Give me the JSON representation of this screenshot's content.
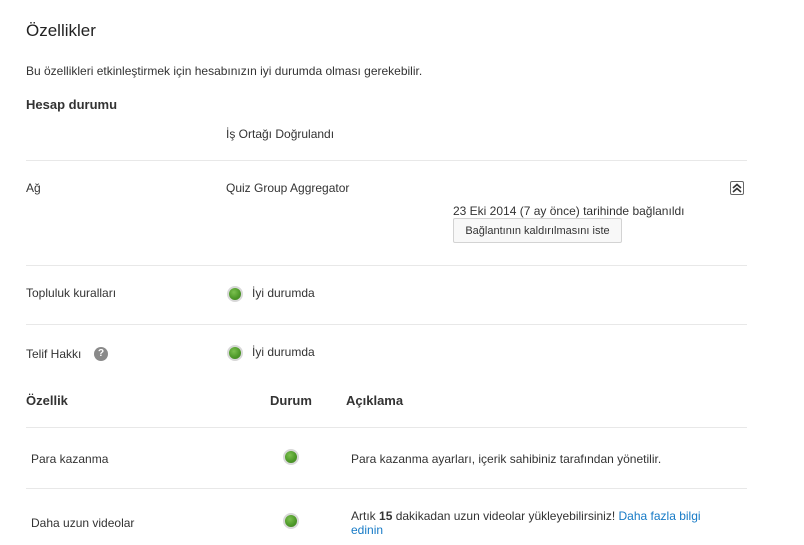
{
  "page": {
    "title": "Özellikler",
    "subtitle": "Bu özellikleri etkinleştirmek için hesabınızın iyi durumda olması gerekebilir."
  },
  "account": {
    "section_title": "Hesap durumu",
    "status": "İş Ortağı Doğrulandı"
  },
  "network": {
    "label": "Ağ",
    "name": "Quiz Group Aggregator",
    "connected_text": "23 Eki 2014 (7 ay önce) tarihinde bağlanıldı",
    "unlink_button": "Bağlantının kaldırılmasını iste",
    "collapse_icon": "collapse-icon"
  },
  "community": {
    "label": "Topluluk kuralları",
    "status": "İyi durumda",
    "status_color": "#4f9a2a"
  },
  "copyright": {
    "label": "Telif Hakkı",
    "help_icon": "?",
    "status": "İyi durumda"
  },
  "features_table": {
    "headers": {
      "feature": "Özellik",
      "status": "Durum",
      "description": "Açıklama"
    },
    "rows": [
      {
        "name": "Para kazanma",
        "description": "Para kazanma ayarları, içerik sahibiniz tarafından yönetilir."
      },
      {
        "name": "Daha uzun videolar",
        "description_pre": "Artık ",
        "description_bold": "15",
        "description_post": " dakikadan uzun videolar yükleyebilirsiniz! ",
        "link_text_1": "Daha fazla bilgi",
        "link_text_2": "edinin"
      }
    ]
  }
}
